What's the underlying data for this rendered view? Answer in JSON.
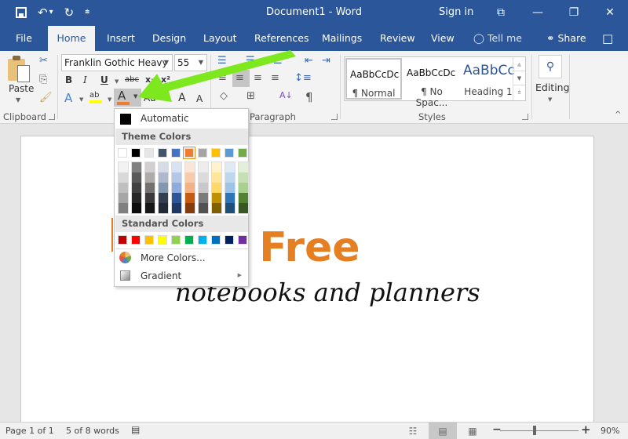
{
  "titlebar": {
    "title": "Document1  -  Word",
    "sign_in": "Sign in",
    "qat": {
      "save_icon": "save-icon",
      "undo_icon": "↶",
      "undo_caret": "▾",
      "redo_icon": "↻",
      "customize_icon": "⩧"
    },
    "window_buttons": {
      "ribbon_options": "⧉",
      "minimize": "—",
      "restore": "❐",
      "close": "✕"
    }
  },
  "tabs": {
    "items": [
      {
        "label": "File"
      },
      {
        "label": "Home",
        "active": true
      },
      {
        "label": "Insert"
      },
      {
        "label": "Design"
      },
      {
        "label": "Layout"
      },
      {
        "label": "References"
      },
      {
        "label": "Mailings"
      },
      {
        "label": "Review"
      },
      {
        "label": "View"
      }
    ],
    "tell_me": "Tell me",
    "tell_me_icon": "💡",
    "share": "Share",
    "share_icon": "♀",
    "comments_icon": "🗨"
  },
  "ribbon": {
    "clipboard": {
      "label": "Clipboard",
      "paste": "Paste",
      "cut_icon": "✂",
      "copy_icon": "⎘",
      "format_painter_icon": "🖌"
    },
    "font": {
      "font_name": "Franklin Gothic Heavy",
      "font_size": "55",
      "bold": "B",
      "italic": "I",
      "underline": "U",
      "strikethrough": "abc",
      "subscript": "x₂",
      "superscript": "x²",
      "text_effects": "A",
      "highlight": "ab",
      "font_color": "A",
      "font_color_value": "#ed7d31",
      "highlight_color_value": "#ffff00",
      "change_case": "Aa",
      "grow_font": "A",
      "shrink_font": "A"
    },
    "paragraph": {
      "label": "Paragraph",
      "bullets": "☰",
      "numbering": "☰",
      "multilevel": "☰",
      "decrease_indent": "⇤",
      "increase_indent": "⇥",
      "align_left": "≡",
      "align_center": "≡",
      "align_right": "≡",
      "justify": "≡",
      "line_spacing": "↕≡",
      "shading": "◇",
      "borders": "⊞",
      "sort": "A↓",
      "show_marks": "¶"
    },
    "styles": {
      "label": "Styles",
      "items": [
        {
          "preview": "AaBbCcDc",
          "name": "¶ Normal",
          "selected": true
        },
        {
          "preview": "AaBbCcDc",
          "name": "¶ No Spac..."
        },
        {
          "preview": "AaBbCc",
          "name": "Heading 1"
        }
      ]
    },
    "editing": {
      "label": "Editing",
      "icon": "⚲"
    }
  },
  "document": {
    "headline": "Get 1 Free",
    "headline_color": "#e67e22",
    "subline": "notebooks and planners"
  },
  "color_menu": {
    "automatic": "Automatic",
    "automatic_color": "#000000",
    "theme_header": "Theme Colors",
    "theme_colors": [
      "#ffffff",
      "#000000",
      "#e7e6e6",
      "#44546a",
      "#4472c4",
      "#ed7d31",
      "#a5a5a5",
      "#ffc000",
      "#5b9bd5",
      "#70ad47"
    ],
    "theme_selected_index": 5,
    "theme_shades": [
      [
        "#f2f2f2",
        "#d9d9d9",
        "#bfbfbf",
        "#a6a6a6",
        "#808080"
      ],
      [
        "#808080",
        "#595959",
        "#404040",
        "#262626",
        "#0d0d0d"
      ],
      [
        "#d0cece",
        "#aeabab",
        "#757171",
        "#3a3838",
        "#171616"
      ],
      [
        "#d6dce5",
        "#adb9ca",
        "#8497b0",
        "#333f50",
        "#222a35"
      ],
      [
        "#d9e2f3",
        "#b4c7e7",
        "#8faadc",
        "#2f5597",
        "#1f3864"
      ],
      [
        "#fbe5d6",
        "#f8cbad",
        "#f4b183",
        "#c55a11",
        "#843c0c"
      ],
      [
        "#ededed",
        "#dbdbdb",
        "#c9c9c9",
        "#7b7b7b",
        "#525252"
      ],
      [
        "#fff2cc",
        "#ffe699",
        "#ffd966",
        "#bf9000",
        "#7f6000"
      ],
      [
        "#deebf7",
        "#bdd7ee",
        "#9dc3e6",
        "#2e75b6",
        "#1f4e79"
      ],
      [
        "#e2f0d9",
        "#c5e0b4",
        "#a9d18e",
        "#548235",
        "#385723"
      ]
    ],
    "standard_header": "Standard Colors",
    "standard_colors": [
      "#c00000",
      "#ff0000",
      "#ffc000",
      "#ffff00",
      "#92d050",
      "#00b050",
      "#00b0f0",
      "#0070c0",
      "#002060",
      "#7030a0"
    ],
    "more_colors": "More Colors...",
    "gradient": "Gradient"
  },
  "statusbar": {
    "page": "Page 1 of 1",
    "words": "5 of 8 words",
    "proofing_icon": "📖",
    "read_mode_icon": "▤",
    "print_layout_icon": "▤",
    "web_layout_icon": "▦",
    "zoom_out": "−",
    "zoom_in": "+",
    "zoom_level": "90%",
    "zoom_fraction": 0.9
  }
}
